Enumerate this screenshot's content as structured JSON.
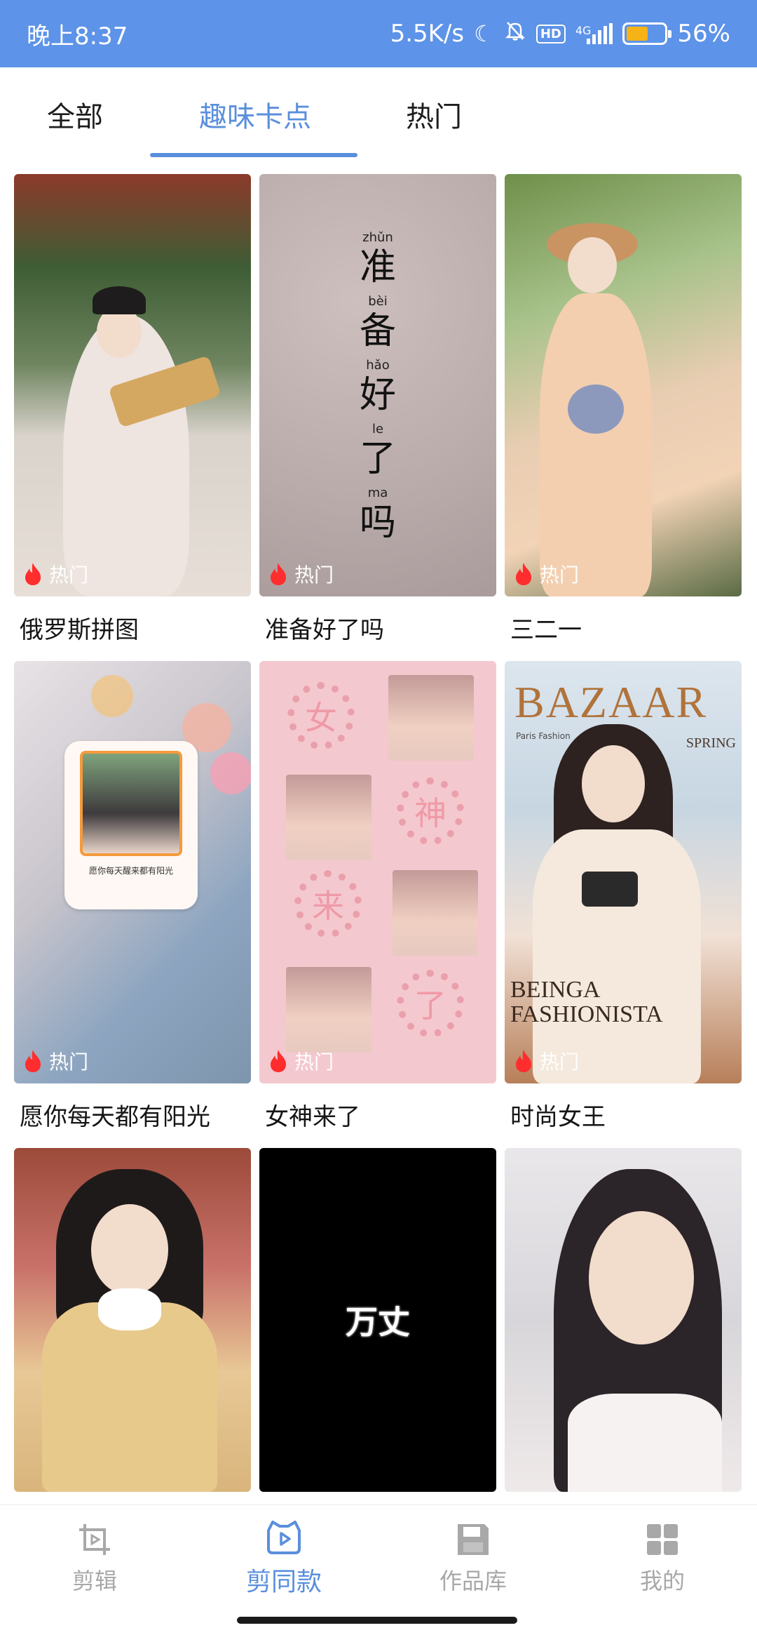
{
  "status_bar": {
    "time": "晚上8:37",
    "net_speed": "5.5K/s",
    "hd_badge": "HD",
    "network_type": "4G",
    "battery_percent": "56%",
    "battery_level": 0.56,
    "icons": [
      "moon-icon",
      "bell-off-icon",
      "hd-icon",
      "signal-icon",
      "battery-icon"
    ]
  },
  "tabs": [
    {
      "label": "全部",
      "active": false
    },
    {
      "label": "趣味卡点",
      "active": true
    },
    {
      "label": "热门",
      "active": false
    }
  ],
  "hot_label": "热门",
  "cards": [
    {
      "title": "俄罗斯拼图",
      "hot": true
    },
    {
      "title": "准备好了吗",
      "hot": true,
      "overlay": {
        "pinyin": [
          "zhǔn",
          "bèi",
          "hǎo",
          "le",
          "ma"
        ],
        "chars": [
          "准",
          "备",
          "好",
          "了",
          "吗"
        ]
      }
    },
    {
      "title": "三二一",
      "hot": true
    },
    {
      "title": "愿你每天都有阳光",
      "hot": true,
      "overlay": {
        "caption": "愿你每天醒来都有阳光"
      }
    },
    {
      "title": "女神来了",
      "hot": true,
      "overlay": {
        "chars": [
          "女",
          "神",
          "来",
          "了"
        ]
      }
    },
    {
      "title": "时尚女王",
      "hot": true,
      "overlay": {
        "magazine": "BAZAAR",
        "subtitle": "Paris Fashion",
        "season": "SPRING",
        "footer": "BEINGA FASHIONISTA"
      }
    },
    {
      "title": "",
      "hot": false
    },
    {
      "title": "",
      "hot": false,
      "overlay": {
        "text": "万丈"
      }
    },
    {
      "title": "",
      "hot": false
    }
  ],
  "bottom_nav": [
    {
      "label": "剪辑",
      "icon": "crop-play-icon",
      "active": false
    },
    {
      "label": "剪同款",
      "icon": "template-play-icon",
      "active": true
    },
    {
      "label": "作品库",
      "icon": "save-disk-icon",
      "active": false
    },
    {
      "label": "我的",
      "icon": "grid-icon",
      "active": false
    }
  ],
  "colors": {
    "status_bar": "#5d93e8",
    "accent": "#5a8fdc",
    "inactive_nav": "#a8a8a8",
    "hot_flame": "#ff2d2d",
    "battery_fill": "#f5b318"
  }
}
